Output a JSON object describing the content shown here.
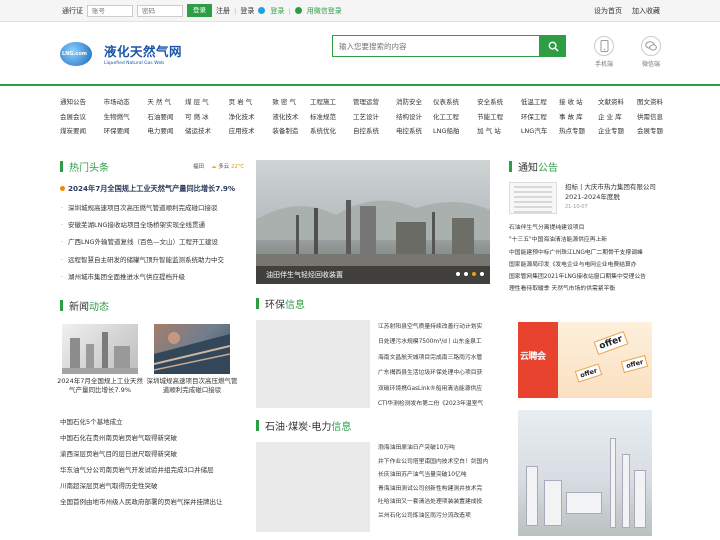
{
  "topbar": {
    "passport": "通行证",
    "account_placeholder": "账号",
    "password_placeholder": "密码",
    "login_btn": "登录",
    "register": "注册",
    "login_link": "登录",
    "qq_login": "登录",
    "wechat_login": "用微信登录",
    "set_home": "设为首页",
    "add_fav": "加入收藏"
  },
  "header": {
    "logo_cn": "液化天然气网",
    "logo_en": "Liquefied Natural Gas Web",
    "logo_badge": "LNG.com",
    "search_placeholder": "输入您要搜索的内容",
    "mobile_label": "手机端",
    "wechat_label": "微信端"
  },
  "nav": {
    "groups": [
      [
        "通知公告",
        "市场动态",
        "天 然 气",
        "会展会议",
        "生物燃气",
        "石油要闻",
        "煤炭要闻",
        "环保要闻",
        "电力要闻"
      ],
      [
        "煤 层 气",
        "页 岩 气",
        "致 密 气",
        "可 燃 冰",
        "净化技术",
        "液化技术",
        "储运技术",
        "应用技术",
        "装备制造"
      ],
      [
        "工程施工",
        "管理运营",
        "消防安全",
        "标准规范",
        "工艺设计",
        "结构设计",
        "系统优化",
        "自控系统",
        "电控系统"
      ],
      [
        "仪表系统",
        "安全系统",
        "低温工程",
        "化工工程",
        "节能工程",
        "环保工程",
        "LNG船舶",
        "加 气 站",
        "LNG汽车"
      ],
      [
        "接 收 站",
        "文献资料",
        "图文资料",
        "事 故 库",
        "企 业 库",
        "供需信息",
        "热点专题",
        "企业专题",
        "会展专题"
      ]
    ]
  },
  "hot": {
    "title_a": "热门",
    "title_b": "头条",
    "weather_city": "福田",
    "weather_desc": "多云",
    "weather_temp": "22℃",
    "lead": "2024年7月全国规上工业天然气产量同比增长7.9%",
    "items": [
      "深圳城规高速项目次高压燃气管道顺利完成碰口接驳",
      "安徽芜湖LNG接收站项目全场桥架实现全线贯通",
      "广西LNG外输管道复线（百色—文山）工程开工建设",
      "远程智慧自主研发的储罐气顶升智能监测系统助力中交",
      "湖州城市集团全面推进水气供应提档升级"
    ]
  },
  "slider": {
    "caption": "油田伴生气轻烃回收装置",
    "active_dot": 3,
    "dot_count": 4
  },
  "notice": {
    "title_a": "通知",
    "title_b": "公告",
    "feat_title": "招标 | 大庆市热力集团有限公司2021-2024年度脱",
    "feat_date": "21-10-07",
    "items": [
      "石油伴生气分离提纯建设项目",
      "\"十三五\"中国海油清洁能源供应再上新",
      "中国能建预中标广州珠江LNG电厂二期骨干支撑调峰",
      "国家能源局印发《发电企业与电网企业电费结算办",
      "国家管网集团2021年LNG接收站窗口期集中受理公告",
      "理性看待取暖季 天然气市场的供需紧平衡"
    ]
  },
  "news": {
    "title_a": "新闻",
    "title_b": "动态",
    "pic1_caption": "2024年7月全国规上工业天然气产量同比增长7.9%",
    "pic2_caption": "深圳城规高速项目次高压燃气管道顺利完成碰口接驳",
    "items": [
      "中国石化5个基地成立",
      "中国石化在贵州南页岩页岩气取得新突破",
      "渝西深层页岩气目的层日进尺取得新突破",
      "华东油气分公司南页岩气开发试验井组完成3口井储层",
      "川南超深层页岩气取得历史性突破",
      "全国首例由地市州级人民政府部署的页岩气探井挂牌出让"
    ]
  },
  "env": {
    "title_a": "环保",
    "title_b": "信息",
    "items": [
      "江苏射阳县空气质量持续改善行动计划实",
      "日处理污水规模7500m³/d丨山东金泉工",
      "海南文昌航天城项目完成南三路雨污水管",
      "广东揭西县生活垃圾环保处理中心项目获",
      "双碳环境携GasLink®船用清洁能源供应",
      "CTI华测检测发布第二份《2023年温室气"
    ]
  },
  "oil": {
    "title_a": "石油",
    "title_b": "·煤炭·电力",
    "title_c": "信息",
    "items": [
      "渤海油田原油日产突破10万吨",
      "井下作业公司塔里甫国内技术空白！剑国内",
      "长庆油田苏产油气当量突破10亿吨",
      "青海油田测试公司创新性构建测井技术完",
      "吐哈油田又一套清洁处理项装装置建成投",
      "兰州石化公司炼油区雨污分流改造项"
    ]
  },
  "ad": {
    "banner_text": "云聘会",
    "offer_word": "offer"
  }
}
